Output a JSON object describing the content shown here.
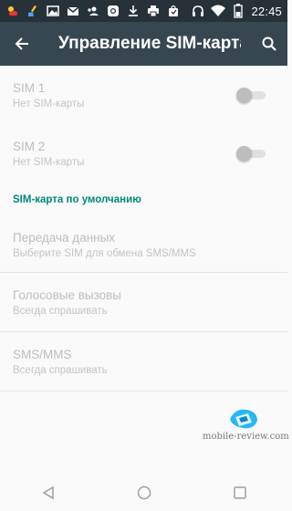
{
  "status_bar": {
    "time": "22:45",
    "notification_icons": [
      "weather-icon",
      "broom-icon",
      "gallery-icon",
      "gmail-icon",
      "add-contact-icon",
      "instagram-icon",
      "download-icon",
      "print-icon",
      "shopping-bag-icon"
    ],
    "system_icons": [
      "headset-icon",
      "wifi-icon",
      "battery-icon"
    ]
  },
  "toolbar": {
    "title": "Управление SIM-карта",
    "back_icon": "arrow-back-icon",
    "search_icon": "search-icon"
  },
  "sims": [
    {
      "title": "SIM 1",
      "subtitle": "Нет SIM-карты",
      "enabled": false
    },
    {
      "title": "SIM 2",
      "subtitle": "Нет SIM-карты",
      "enabled": false
    }
  ],
  "default_section": {
    "header": "SIM-карта по умолчанию",
    "items": [
      {
        "title": "Передача данных",
        "subtitle": "Выберите SIM для обмена SMS/MMS"
      },
      {
        "title": "Голосовые вызовы",
        "subtitle": "Всегда спрашивать"
      },
      {
        "title": "SMS/MMS",
        "subtitle": "Всегда спрашивать"
      }
    ]
  },
  "watermark": "mobile-review.com",
  "nav": [
    "back-nav-icon",
    "home-nav-icon",
    "recents-nav-icon"
  ],
  "colors": {
    "status_bar": "#263238",
    "toolbar": "#37474f",
    "accent": "#00897b",
    "disabled_text": "#bdbdbd"
  }
}
